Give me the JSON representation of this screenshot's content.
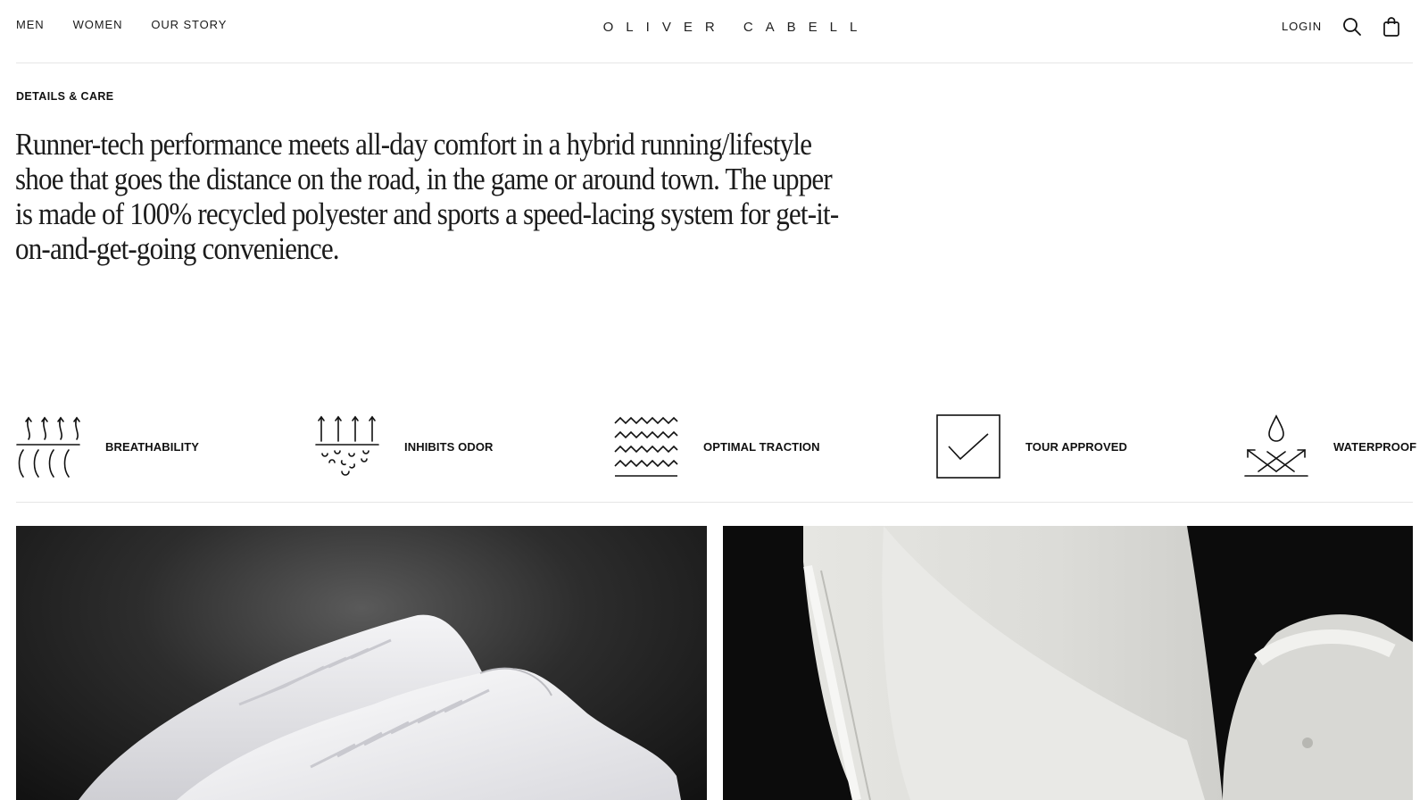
{
  "header": {
    "nav_left": [
      "MEN",
      "WOMEN",
      "OUR STORY"
    ],
    "logo": "OLIVER CABELL",
    "login": "LOGIN",
    "icons": [
      "search-icon",
      "shopping-bag-icon"
    ]
  },
  "details": {
    "label": "DETAILS & CARE",
    "description": "Runner-tech performance meets all-day comfort in a hybrid running/lifestyle shoe that goes the distance on the road, in the game or around town. The upper is made of 100% recycled polyester and sports a speed-lacing system for get-it-on-and-get-going convenience."
  },
  "features": [
    {
      "label": "BREATHABILITY",
      "icon": "breathability-icon"
    },
    {
      "label": "INHIBITS ODOR",
      "icon": "inhibits-odor-icon"
    },
    {
      "label": "OPTIMAL TRACTION",
      "icon": "traction-icon"
    },
    {
      "label": "TOUR APPROVED",
      "icon": "checkmark-box-icon"
    },
    {
      "label": "WATERPROOF",
      "icon": "waterproof-icon"
    }
  ],
  "images": [
    {
      "subject": "white-leather-sneakers-pair"
    },
    {
      "subject": "white-sneaker-closeup"
    }
  ]
}
